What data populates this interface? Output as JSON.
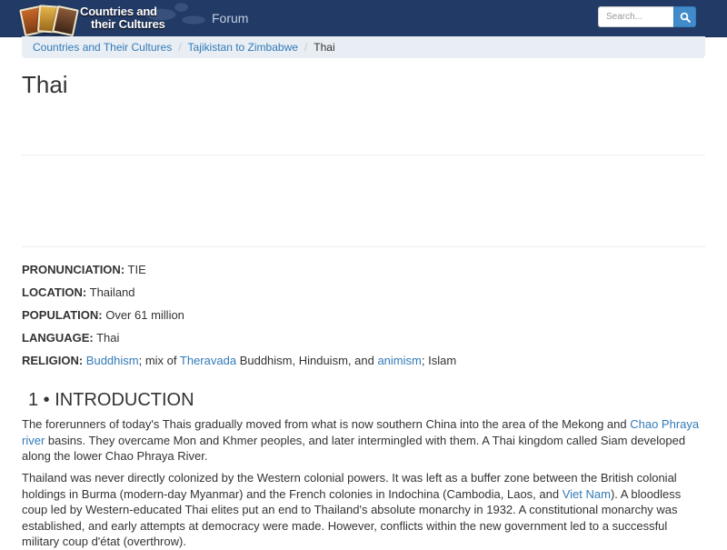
{
  "navbar": {
    "logo_line1": "Countries and",
    "logo_line2": "their Cultures",
    "forum_label": "Forum",
    "search_placeholder": "Search..."
  },
  "breadcrumb": {
    "items": [
      "Countries and Their Cultures",
      "Tajikistan to Zimbabwe"
    ],
    "separator": "/",
    "current": "Thai"
  },
  "page": {
    "title": "Thai"
  },
  "facts": {
    "pronunciation": {
      "label": "PRONUNCIATION:",
      "value": "TIE"
    },
    "location": {
      "label": "LOCATION:",
      "value": "Thailand"
    },
    "population": {
      "label": "POPULATION:",
      "value": "Over 61 million"
    },
    "language": {
      "label": "LANGUAGE:",
      "value": "Thai"
    },
    "religion": {
      "label": "RELIGION:",
      "link1": "Buddhism",
      "text1": "; mix of",
      "link2": "Theravada",
      "text2": "Buddhism, Hinduism, and",
      "link3": "animism",
      "text3": "; Islam"
    }
  },
  "section": {
    "heading": "1 • INTRODUCTION",
    "p1": {
      "text_a": "The forerunners of today's Thais gradually moved from what is now southern China into the area of the Mekong and ",
      "link": "Chao Phraya river",
      "text_b": " basins. They overcame Mon and Khmer peoples, and later intermingled with them. A Thai kingdom called Siam developed along the lower Chao Phraya River."
    },
    "p2": {
      "text_a": "Thailand was never directly colonized by the Western colonial powers. It was left as a buffer zone between the British colonial holdings in Burma (modern-day Myanmar) and the French colonies in Indochina (Cambodia, Laos, and ",
      "link": "Viet Nam",
      "text_b": "). A bloodless coup led by Western-educated Thai elites put an end to Thailand's absolute monarchy in 1932. A constitutional monarchy was established, and early attempts at democracy were made. However, conflicts within the new government led to a successful military coup d'état (overthrow)."
    }
  },
  "colors": {
    "navbar": "#223a66",
    "link": "#337ab7",
    "search_button": "#428bca",
    "breadcrumb_bg": "#e8eef4"
  },
  "icons": {
    "logo": "logo-tiles-icon",
    "search": "search-icon"
  }
}
